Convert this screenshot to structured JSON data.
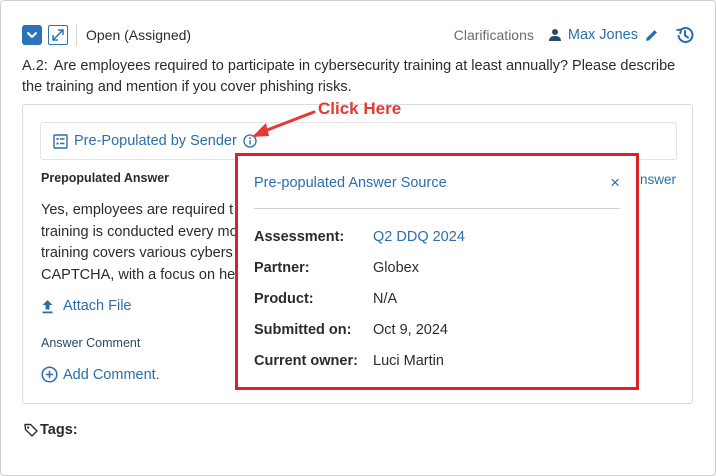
{
  "header": {
    "status": "Open (Assigned)",
    "clarifications_label": "Clarifications",
    "owner_name": "Max Jones"
  },
  "question": {
    "number": "A.2:",
    "text": "Are employees required to participate in cybersecurity training at least annually? Please describe the training and mention if you cover phishing risks."
  },
  "prepopulated_bar": {
    "label": "Pre-Populated by Sender"
  },
  "answer_section": {
    "label": "Prepopulated Answer",
    "edit_link_partial": "nswer",
    "lines": [
      "Yes, employees are required t",
      "training is conducted every mo",
      "training covers various cybers",
      "CAPTCHA, with a focus on help"
    ],
    "attach_label": "Attach File",
    "comment_label": "Answer Comment",
    "add_comment_label": "Add Comment."
  },
  "tags_label": "Tags:",
  "annotation": {
    "callout_text": "Click Here"
  },
  "popup": {
    "title": "Pre-populated Answer Source",
    "close_symbol": "×",
    "rows": [
      {
        "key": "Assessment:",
        "value": "Q2 DDQ 2024"
      },
      {
        "key": "Partner:",
        "value": "Globex"
      },
      {
        "key": "Product:",
        "value": "N/A"
      },
      {
        "key": "Submitted on:",
        "value": "Oct 9, 2024"
      },
      {
        "key": "Current owner:",
        "value": "Luci Martin"
      }
    ]
  },
  "colors": {
    "accent_blue": "#2b6ea8",
    "checkbox_blue": "#2b73b8",
    "highlight_red": "#d8232a",
    "callout_red": "#e53935"
  },
  "icons": [
    "chevron-down-icon",
    "expand-icon",
    "user-icon",
    "pencil-icon",
    "history-icon",
    "list-icon",
    "info-icon",
    "upload-icon",
    "plus-circle-icon",
    "tag-icon",
    "close-icon",
    "arrow-icon"
  ]
}
